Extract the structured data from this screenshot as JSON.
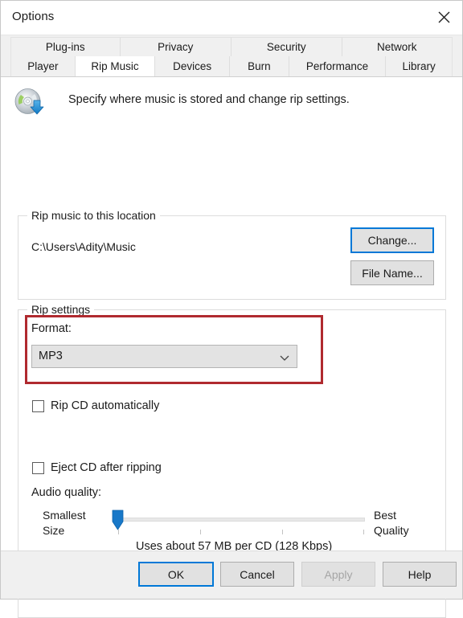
{
  "window": {
    "title": "Options",
    "close_icon": "close-icon"
  },
  "tabs": {
    "row1": [
      {
        "label": "Plug-ins",
        "selected": false
      },
      {
        "label": "Privacy",
        "selected": false
      },
      {
        "label": "Security",
        "selected": false
      },
      {
        "label": "Network",
        "selected": false
      }
    ],
    "row2": [
      {
        "label": "Player",
        "selected": false
      },
      {
        "label": "Rip Music",
        "selected": true
      },
      {
        "label": "Devices",
        "selected": false
      },
      {
        "label": "Burn",
        "selected": false
      },
      {
        "label": "Performance",
        "selected": false
      },
      {
        "label": "Library",
        "selected": false
      }
    ]
  },
  "header": {
    "icon": "rip-cd-icon",
    "description": "Specify where music is stored and change rip settings."
  },
  "location_group": {
    "legend": "Rip music to this location",
    "path": "C:\\Users\\Adity\\Music",
    "change_button": "Change...",
    "file_name_button": "File Name..."
  },
  "rip_settings_group": {
    "legend": "Rip settings",
    "format_label": "Format:",
    "format_value": "MP3",
    "format_arrow_icon": "chevron-down-icon",
    "rip_cd_automatically": "Rip CD automatically",
    "rip_cd_automatically_checked": false,
    "eject_cd_after_ripping": "Eject CD after ripping",
    "eject_cd_after_ripping_checked": false,
    "audio_quality_label": "Audio quality:",
    "slider_min_label_line1": "Smallest",
    "slider_min_label_line2": "Size",
    "slider_max_label_line1": "Best",
    "slider_max_label_line2": "Quality",
    "quality_note": "Uses about 57 MB per CD (128 Kbps)",
    "slider_value_percent": 0
  },
  "highlight": {
    "color": "#b02a2f"
  },
  "footer": {
    "ok": "OK",
    "cancel": "Cancel",
    "apply": "Apply",
    "help": "Help"
  },
  "colors": {
    "accent": "#0078d7",
    "button_face": "#e1e1e1",
    "highlight_red": "#b02a2f"
  }
}
